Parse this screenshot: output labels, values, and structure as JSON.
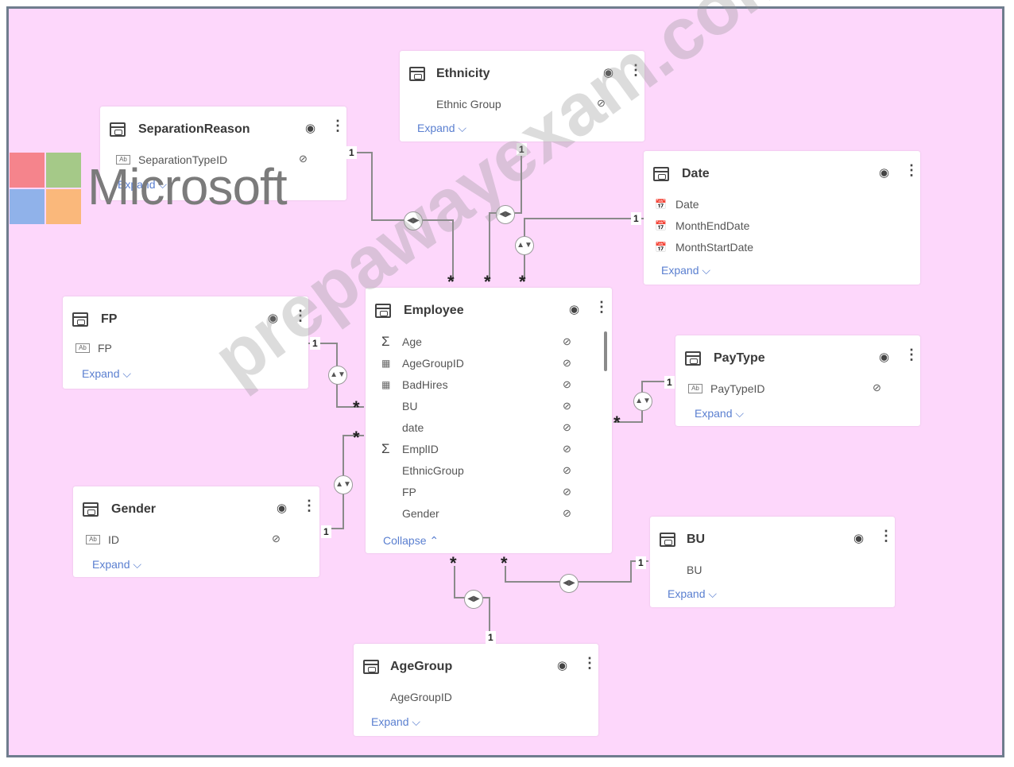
{
  "tables": {
    "ethnicity": {
      "title": "Ethnicity",
      "fields": [
        "Ethnic Group"
      ],
      "link": "Expand ⌵"
    },
    "separation": {
      "title": "SeparationReason",
      "fields": [
        "SeparationTypeID"
      ],
      "link": "Expand ⌵"
    },
    "date": {
      "title": "Date",
      "fields": [
        "Date",
        "MonthEndDate",
        "MonthStartDate"
      ],
      "link": "Expand ⌵"
    },
    "fp": {
      "title": "FP",
      "fields": [
        "FP"
      ],
      "link": "Expand ⌵"
    },
    "employee": {
      "title": "Employee",
      "fields": [
        "Age",
        "AgeGroupID",
        "BadHires",
        "BU",
        "date",
        "EmplID",
        "EthnicGroup",
        "FP",
        "Gender"
      ],
      "link": "Collapse ⌃"
    },
    "paytype": {
      "title": "PayType",
      "fields": [
        "PayTypeID"
      ],
      "link": "Expand ⌵"
    },
    "gender": {
      "title": "Gender",
      "fields": [
        "ID"
      ],
      "link": "Expand ⌵"
    },
    "bu": {
      "title": "BU",
      "fields": [
        "BU"
      ],
      "link": "Expand ⌵"
    },
    "agegroup": {
      "title": "AgeGroup",
      "fields": [
        "AgeGroupID"
      ],
      "link": "Expand ⌵"
    }
  },
  "cardinality": {
    "one": "1",
    "many": "*"
  },
  "icons": {
    "eye": "eye-icon",
    "hidden": "eye-hidden-icon",
    "more": "more-icon",
    "table": "table-icon"
  },
  "colors": {
    "canvas": "#fdd7fb",
    "frame": "#6f7d8e",
    "link": "#5a7fd0"
  },
  "logo": {
    "word": "Microsoft",
    "tiles": [
      "#f26f70",
      "#8fc56b",
      "#74a9e6",
      "#f9b05b"
    ]
  },
  "watermark": "prepawayexam.com"
}
